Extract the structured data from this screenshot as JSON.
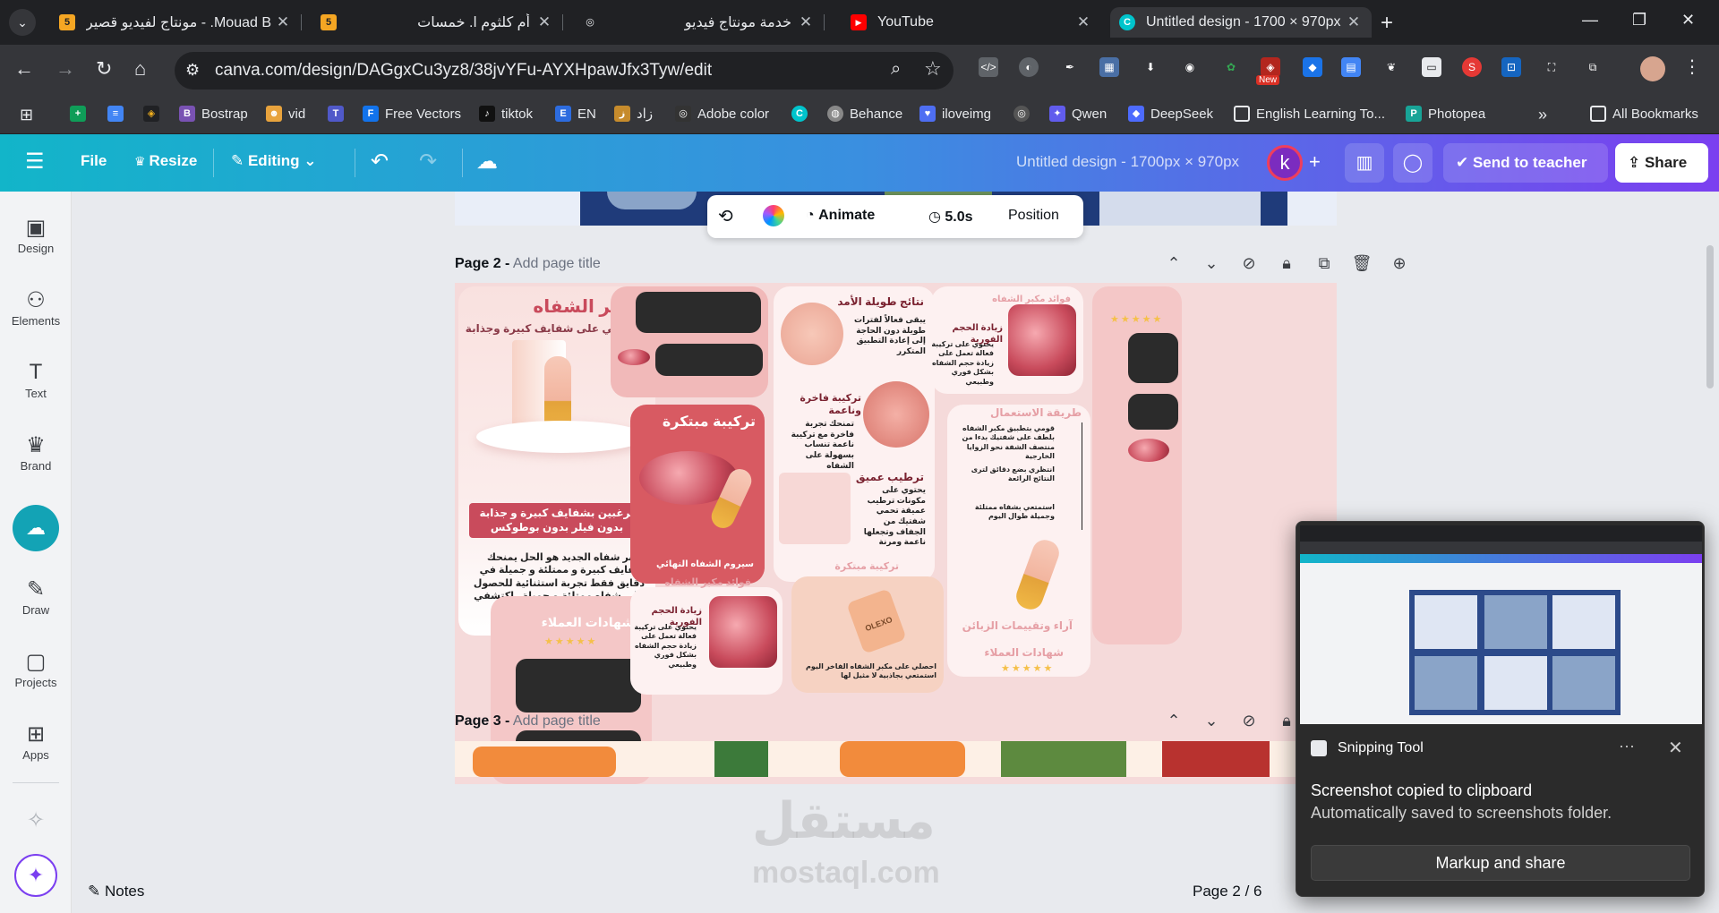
{
  "browser": {
    "tabs": [
      {
        "title": "مونتاج لفيديو قصير - .Mouad B",
        "favicon": "5",
        "color": "#f5a623"
      },
      {
        "title": "أم كلثوم ا. خمسات",
        "favicon": "5",
        "color": "#f5a623"
      },
      {
        "title": "خدمة مونتاج فيديو",
        "favicon": "◎",
        "color": "#e8eaed"
      },
      {
        "title": "YouTube",
        "favicon": "▶",
        "color": "#ff0000"
      },
      {
        "title": "Untitled design - 1700 × 970px",
        "favicon": "C",
        "color": "#00c4cc"
      }
    ],
    "url": "canva.com/design/DAGgxCu3yz8/38jvYFu-AYXHpawJfx3Tyw/edit",
    "ext_new_badge": "New",
    "bookmarks": [
      {
        "label": "Bostrap",
        "icon": "B",
        "color": "#7952b3"
      },
      {
        "label": "vid",
        "icon": "☻",
        "color": "#e8a33d"
      },
      {
        "label": "",
        "icon": "T",
        "color": "#5059c9"
      },
      {
        "label": "Free Vectors",
        "icon": "F",
        "color": "#1273eb"
      },
      {
        "label": "tiktok",
        "icon": "♪",
        "color": "#111"
      },
      {
        "label": "EN",
        "icon": "E",
        "color": "#2d6cdf"
      },
      {
        "label": "زاد",
        "icon": "ز",
        "color": "#c68b2c"
      },
      {
        "label": "Adobe color",
        "icon": "◎",
        "color": "#333"
      },
      {
        "label": "",
        "icon": "C",
        "color": "#00c4cc"
      },
      {
        "label": "Behance",
        "icon": "◍",
        "color": "#888"
      },
      {
        "label": "iloveimg",
        "icon": "♥",
        "color": "#4e6ef2"
      },
      {
        "label": "",
        "icon": "◎",
        "color": "#555"
      },
      {
        "label": "Qwen",
        "icon": "✦",
        "color": "#615ced"
      },
      {
        "label": "DeepSeek",
        "icon": "◆",
        "color": "#4d6bfe"
      },
      {
        "label": "English Learning To...",
        "icon": "▭",
        "color": "#35363a"
      },
      {
        "label": "Photopea",
        "icon": "P",
        "color": "#18a497"
      }
    ],
    "all_bookmarks": "All Bookmarks"
  },
  "canva": {
    "header": {
      "file": "File",
      "resize": "Resize",
      "editing": "Editing",
      "doc_title": "Untitled design - 1700px × 970px",
      "avatar_letter": "k",
      "send_to_teacher": "Send to teacher",
      "share": "Share"
    },
    "sidebar": [
      {
        "label": "Design",
        "icon": "▣"
      },
      {
        "label": "Elements",
        "icon": "⚇"
      },
      {
        "label": "Text",
        "icon": "T"
      },
      {
        "label": "Brand",
        "icon": "♛"
      },
      {
        "label": "",
        "icon": "☁"
      },
      {
        "label": "Draw",
        "icon": "✎"
      },
      {
        "label": "Projects",
        "icon": "▢"
      },
      {
        "label": "Apps",
        "icon": "⊞"
      }
    ],
    "floating_bar": {
      "animate": "Animate",
      "duration": "5.0s",
      "position": "Position"
    },
    "pages": {
      "page2_label": "Page 2 -",
      "page2_add": "Add page title",
      "page3_label": "Page 3 -",
      "page3_add": "Add page title"
    },
    "design": {
      "title": "مكبر الشفاه",
      "subtitle": "احصلي على شفايف كبيرة وجذابة",
      "headline": "ترغبين بشفايف كبيرة و جذابة بدون فيلر بدون بوطوكس",
      "body": "مكبر شفاه الجديد هو الحل يمنحك شفايف كبيرة و ممتلئة و جميلة في دقايق فقط تجربة استثنائية للحصول على شفاه ممتلئة و جميلة . اكتشفي سر جاذبية الشفاه الفورية",
      "innovative": "تركيبة مبتكرة",
      "serum": "سيروم الشفاه النهائي",
      "long_lasting": "نتائج طويلة الأمد",
      "long_lasting_body": "يبقى فعالاً لفترات طويلة دون الحاجة إلى إعادة التطبيق المتكرر",
      "luxury": "تركيبة فاخرة وناعمة",
      "luxury_body": "تمنحك تجربة فاخرة مع تركيبة ناعمة تنساب بسهولة على الشفاه",
      "deep_moist": "ترطيب عميق",
      "deep_moist_body": "يحتوي على مكونات ترطيب عميقة تحمي شفتيك من الجفاف وتجعلها ناعمة ومرنة",
      "volume": "زيادة الحجم الفورية",
      "volume_body": "يحتوي على تركيبة فعالة تعمل على زيادة حجم الشفاه بشكل فوري وطبيعي",
      "benefits": "فوائد مكبر الشفاه",
      "how_to": "طريقة الاستعمال",
      "step1": "قومي بتطبيق مكبر الشفاه بلطف على شفتيك بدءا من منتصف الشفة نحو الزوايا الخارجية",
      "step2": "انتظري بضع دقائق لترى النتائج الرائعة",
      "step3": "استمتعي بشفاه ممتلئة وجميلة طوال اليوم",
      "reviews": "آراء وتقييمات الزبائن",
      "testimonials": "شهادات العملاء",
      "cta": "احصلي على مكبر الشفاه الفاخر اليوم استمتعي بجاذبية لا مثيل لها",
      "stars": "★★★★★",
      "brand": "OLEXO"
    },
    "bottom": {
      "notes": "Notes",
      "page_indicator": "Page 2 / 6"
    },
    "watermark": {
      "line1": "مستقل",
      "line2": "mostaql.com"
    }
  },
  "snipping": {
    "app": "Snipping Tool",
    "title": "Screenshot copied to clipboard",
    "subtitle": "Automatically saved to screenshots folder.",
    "button": "Markup and share"
  }
}
